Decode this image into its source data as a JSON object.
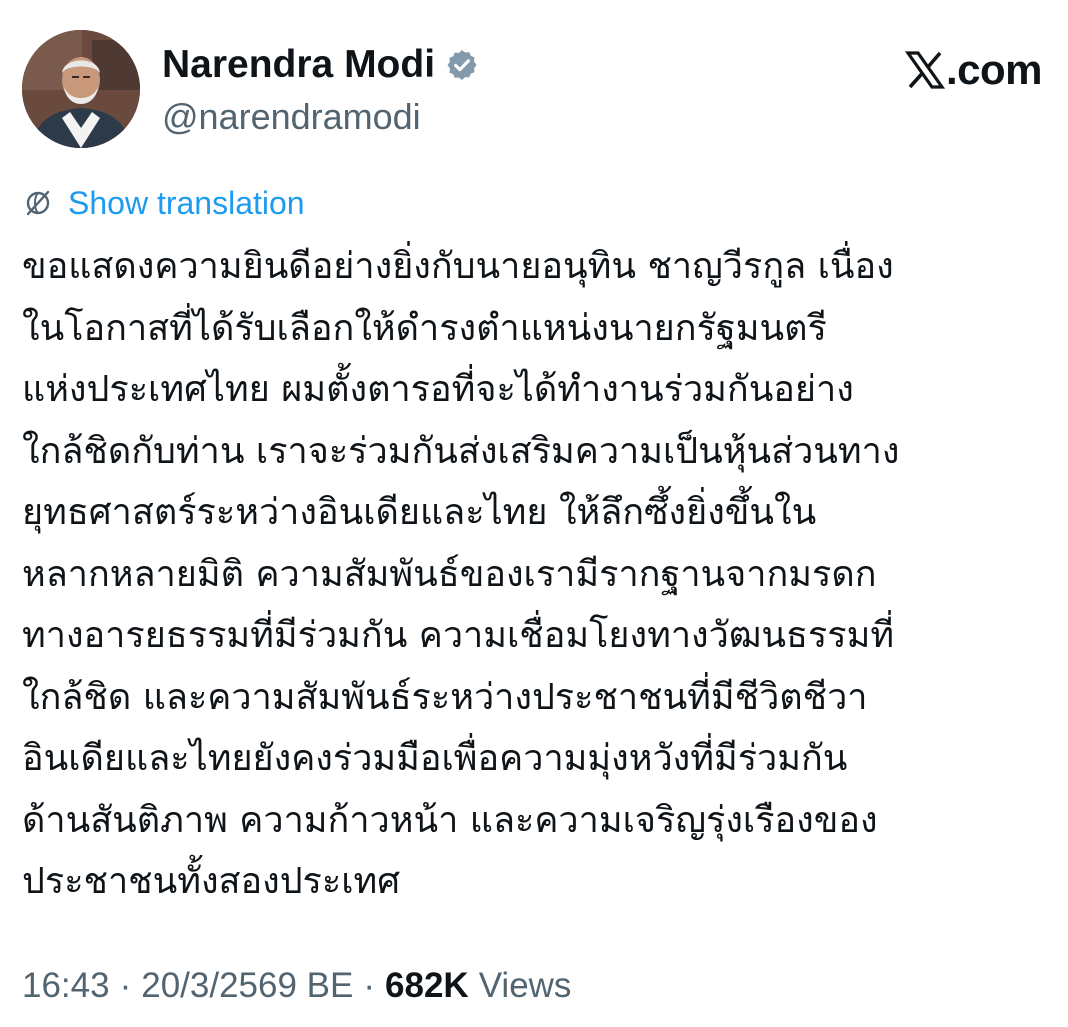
{
  "author": {
    "display_name": "Narendra Modi",
    "handle": "@narendramodi",
    "verified_icon": "verified-badge-icon"
  },
  "brand": {
    "text": "X.com",
    "logo_icon": "x-logo-icon",
    "suffix": ".com"
  },
  "translation": {
    "label": "Show translation",
    "icon": "globe-icon"
  },
  "tweet": {
    "lines": [
      "ขอแสดงความยินดีอย่างยิ่งกับนายอนุทิน ชาญวีรกูล เนื่อง",
      "ในโอกาสที่ได้รับเลือกให้ดำรงตำแหน่งนายกรัฐมนตรี",
      "แห่งประเทศไทย ผมตั้งตารอที่จะได้ทำงานร่วมกันอย่าง",
      "ใกล้ชิดกับท่าน เราจะร่วมกันส่งเสริมความเป็นหุ้นส่วนทาง",
      "ยุทธศาสตร์ระหว่างอินเดียและไทย ให้ลึกซึ้งยิ่งขึ้นใน",
      "หลากหลายมิติ ความสัมพันธ์ของเรามีรากฐานจากมรดก",
      "ทางอารยธรรมที่มีร่วมกัน ความเชื่อมโยงทางวัฒนธรรมที่",
      "ใกล้ชิด และความสัมพันธ์ระหว่างประชาชนที่มีชีวิตชีวา",
      "อินเดียและไทยยังคงร่วมมือเพื่อความมุ่งหวังที่มีร่วมกัน",
      "ด้านสันติภาพ ความก้าวหน้า และความเจริญรุ่งเรืองของ",
      "ประชาชนทั้งสองประเทศ"
    ]
  },
  "meta": {
    "time": "16:43",
    "separator": "·",
    "date": "20/3/2569 BE",
    "views_count": "682K",
    "views_label": "Views"
  },
  "colors": {
    "text": "#0f1419",
    "secondary": "#536471",
    "link": "#1d9bf0"
  }
}
